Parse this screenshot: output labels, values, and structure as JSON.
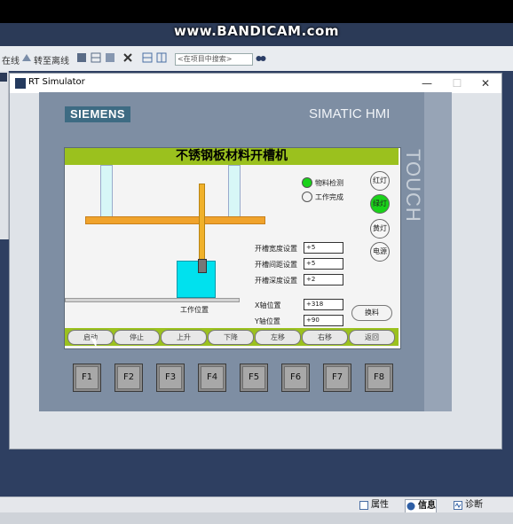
{
  "watermark": "www.BANDICAM.com",
  "toolbar": {
    "online_label": "在线",
    "offline_label": "转至离线",
    "search_placeholder": "<在项目中搜索>"
  },
  "window": {
    "title": "RT Simulator",
    "minimize": "—",
    "maximize": "☐",
    "close": "✕"
  },
  "hmi": {
    "brand": "SIEMENS",
    "model": "SIMATIC HMI",
    "touch": "TOUCH",
    "screen_title": "不锈钢板材料开槽机",
    "work_position_label": "工作位置",
    "lamps": [
      {
        "label": "物料检测",
        "color": "#19d219"
      },
      {
        "label": "工作完成",
        "color": "#f2f2f2"
      }
    ],
    "round_buttons": [
      {
        "label": "红灯",
        "color": "#f6f6f6"
      },
      {
        "label": "绿灯",
        "color": "#19d219"
      },
      {
        "label": "黄灯",
        "color": "#f6f6f6"
      },
      {
        "label": "电源",
        "color": "#f6f6f6"
      }
    ],
    "fields": [
      {
        "label": "开槽宽度设置",
        "value": "+5"
      },
      {
        "label": "开槽间距设置",
        "value": "+5"
      },
      {
        "label": "开槽深度设置",
        "value": "+2"
      },
      {
        "label": "X轴位置",
        "value": "+318"
      },
      {
        "label": "Y轴位置",
        "value": "+90"
      }
    ],
    "change_button": "换料",
    "bottom_buttons": [
      "启动",
      "停止",
      "上升",
      "下降",
      "左移",
      "右移",
      "返回"
    ],
    "fkeys": [
      "F1",
      "F2",
      "F3",
      "F4",
      "F5",
      "F6",
      "F7",
      "F8"
    ]
  },
  "bottom_tabs": {
    "properties": "属性",
    "info": "信息",
    "diagnostics": "诊断"
  }
}
